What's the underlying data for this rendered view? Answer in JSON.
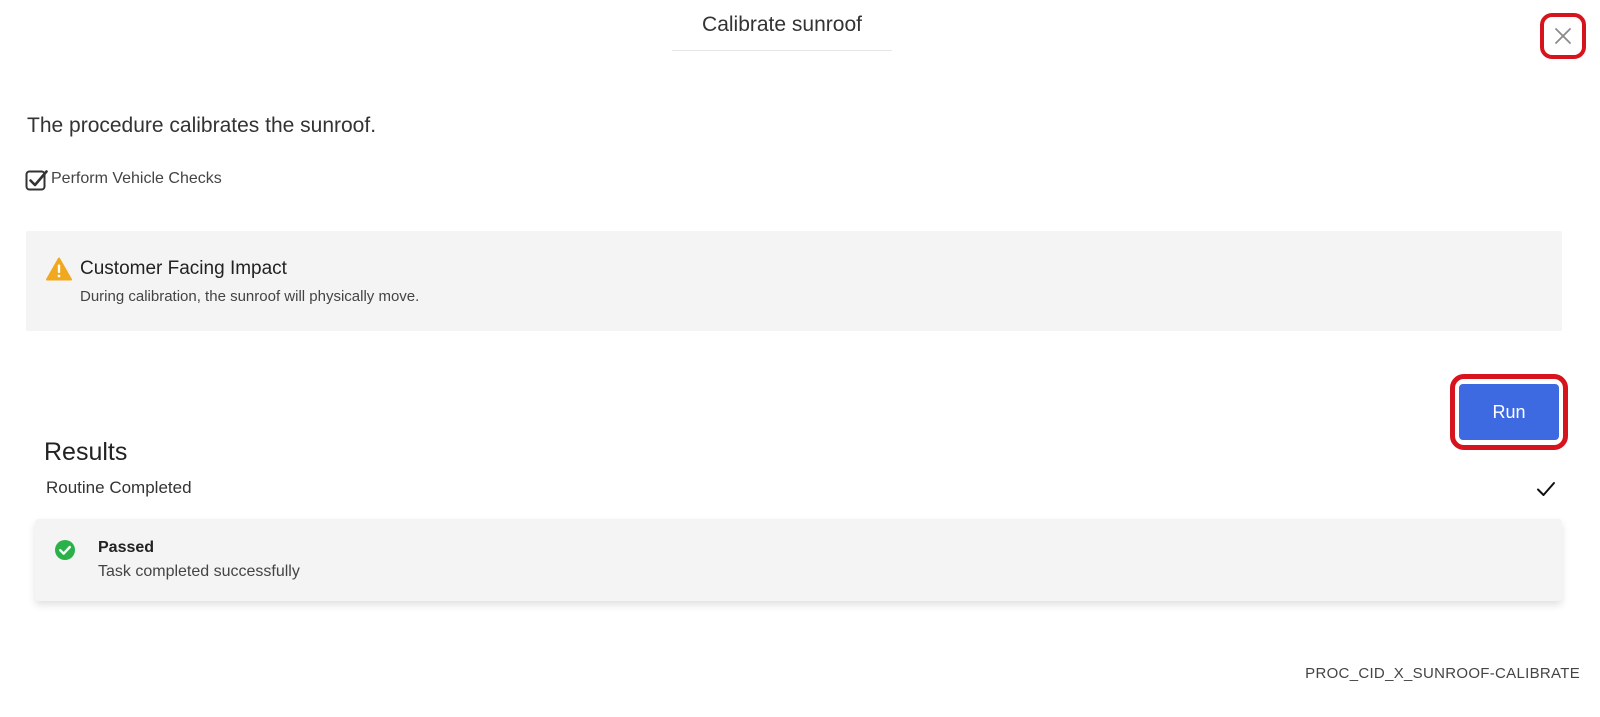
{
  "header": {
    "title": "Calibrate sunroof"
  },
  "description": "The procedure calibrates the sunroof.",
  "vehicle_checks": {
    "label": "Perform Vehicle Checks",
    "checked": true
  },
  "impact": {
    "title": "Customer Facing Impact",
    "text": "During calibration, the sunroof will physically move.",
    "icon": "warning-icon",
    "color": "#f0a81e"
  },
  "actions": {
    "run_label": "Run",
    "run_color": "#3e6ae1",
    "highlight_color": "#d7141d"
  },
  "results": {
    "heading": "Results",
    "routine_label": "Routine Completed",
    "status_title": "Passed",
    "status_text": "Task completed successfully",
    "status_color": "#2bb14a"
  },
  "footer": {
    "procedure_code": "PROC_CID_X_SUNROOF-CALIBRATE"
  }
}
